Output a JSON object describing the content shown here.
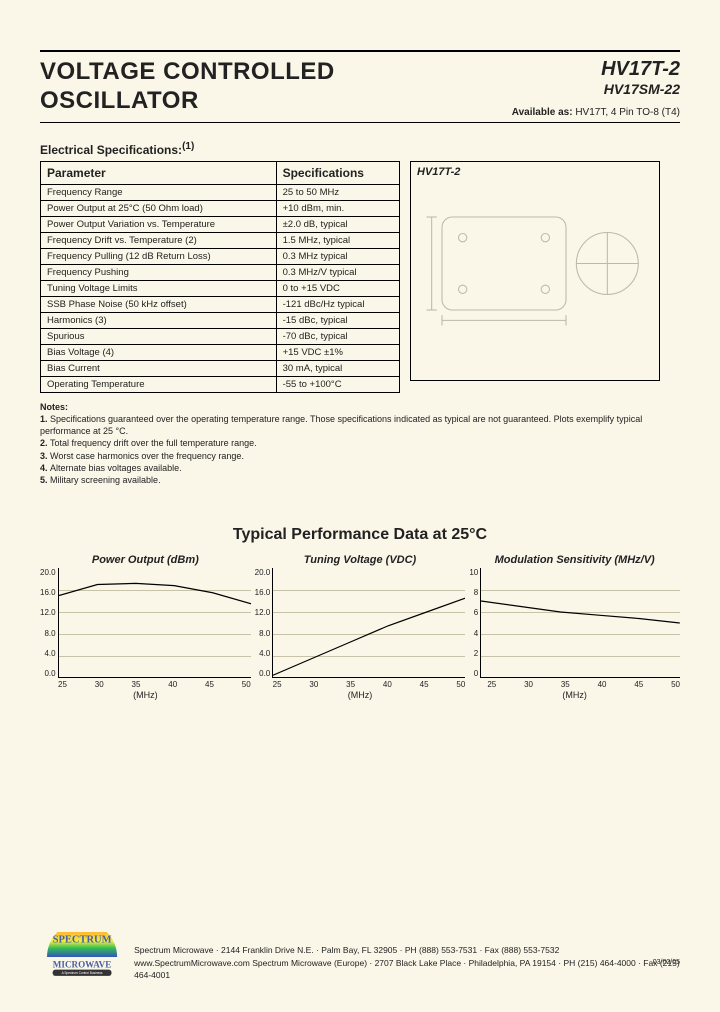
{
  "header": {
    "title_line1": "VOLTAGE CONTROLLED",
    "title_line2": "OSCILLATOR",
    "part_main": "HV17T-2",
    "part_sub": "HV17SM-22",
    "available_label": "Available as:",
    "available_text": " HV17T, 4 Pin TO-8 (T4)"
  },
  "spec_section_title": "Electrical Specifications:",
  "spec_section_sup": "(1)",
  "table": {
    "col1": "Parameter",
    "col2": "Specifications",
    "rows": [
      {
        "p": "Frequency Range",
        "s": "25 to 50 MHz"
      },
      {
        "p": "Power Output at 25°C (50 Ohm load)",
        "s": "+10 dBm, min."
      },
      {
        "p": "Power Output Variation vs. Temperature",
        "s": "±2.0 dB, typical"
      },
      {
        "p": "Frequency Drift vs. Temperature (2)",
        "s": "1.5 MHz, typical"
      },
      {
        "p": "Frequency Pulling (12 dB Return Loss)",
        "s": "0.3 MHz typical"
      },
      {
        "p": "Frequency Pushing",
        "s": "0.3 MHz/V typical"
      },
      {
        "p": "Tuning Voltage Limits",
        "s": "0 to +15 VDC"
      },
      {
        "p": "SSB Phase Noise (50 kHz offset)",
        "s": "-121 dBc/Hz typical"
      },
      {
        "p": "Harmonics (3)",
        "s": "-15 dBc, typical"
      },
      {
        "p": "Spurious",
        "s": "-70 dBc, typical"
      },
      {
        "p": "Bias Voltage (4)",
        "s": "+15 VDC ±1%"
      },
      {
        "p": "Bias Current",
        "s": "30 mA, typical"
      },
      {
        "p": "Operating Temperature",
        "s": "-55 to +100°C"
      }
    ]
  },
  "diagram_label": "HV17T-2",
  "notes": {
    "title": "Notes:",
    "items": [
      "Specifications guaranteed over the operating temperature range. Those specifications indicated as typical are not guaranteed. Plots exemplify typical performance at 25 °C.",
      "Total frequency drift over the full temperature range.",
      "Worst case harmonics over the frequency range.",
      "Alternate bias voltages available.",
      "Military screening available."
    ]
  },
  "perf_title": "Typical Performance Data at 25°C",
  "chart_data": [
    {
      "type": "line",
      "title": "Power Output (dBm)",
      "xlabel": "(MHz)",
      "x": [
        25,
        30,
        35,
        40,
        45,
        50
      ],
      "y_ticks": [
        20.0,
        16.0,
        12.0,
        8.0,
        4.0,
        0.0
      ],
      "series": [
        {
          "name": "out",
          "values": [
            15.0,
            17.0,
            17.2,
            16.8,
            15.5,
            13.5
          ]
        }
      ],
      "ylim": [
        0,
        20
      ]
    },
    {
      "type": "line",
      "title": "Tuning Voltage (VDC)",
      "xlabel": "(MHz)",
      "x": [
        25,
        30,
        35,
        40,
        45,
        50
      ],
      "y_ticks": [
        20.0,
        16.0,
        12.0,
        8.0,
        4.0,
        0.0
      ],
      "series": [
        {
          "name": "vt",
          "values": [
            0.5,
            3.5,
            6.5,
            9.5,
            12.0,
            14.5
          ]
        }
      ],
      "ylim": [
        0,
        20
      ]
    },
    {
      "type": "line",
      "title": "Modulation Sensitivity (MHz/V)",
      "xlabel": "(MHz)",
      "x": [
        25,
        30,
        35,
        40,
        45,
        50
      ],
      "y_ticks": [
        10,
        8,
        6,
        4,
        2,
        0
      ],
      "series": [
        {
          "name": "ms",
          "values": [
            7.0,
            6.5,
            6.0,
            5.7,
            5.4,
            5.0
          ]
        }
      ],
      "ylim": [
        0,
        10
      ]
    }
  ],
  "footer": {
    "logo_top": "SPECTRUM",
    "logo_bottom": "MICROWAVE",
    "logo_tag": "A Spectrum Control Business",
    "line1_company": "Spectrum Microwave",
    "line1_addr": " · 2144 Franklin Drive N.E. · Palm Bay, FL 32905 · PH (888) 553-7531 · Fax (888) 553-7532",
    "line2_site": "www.SpectrumMicrowave.com",
    "line2_company": " Spectrum Microwave (Europe)",
    "line2_addr": " · 2707 Black Lake Place · Philadelphia, PA 19154 · PH (215) 464-4000 · Fax (215) 464-4001",
    "date": "03/02/05"
  }
}
